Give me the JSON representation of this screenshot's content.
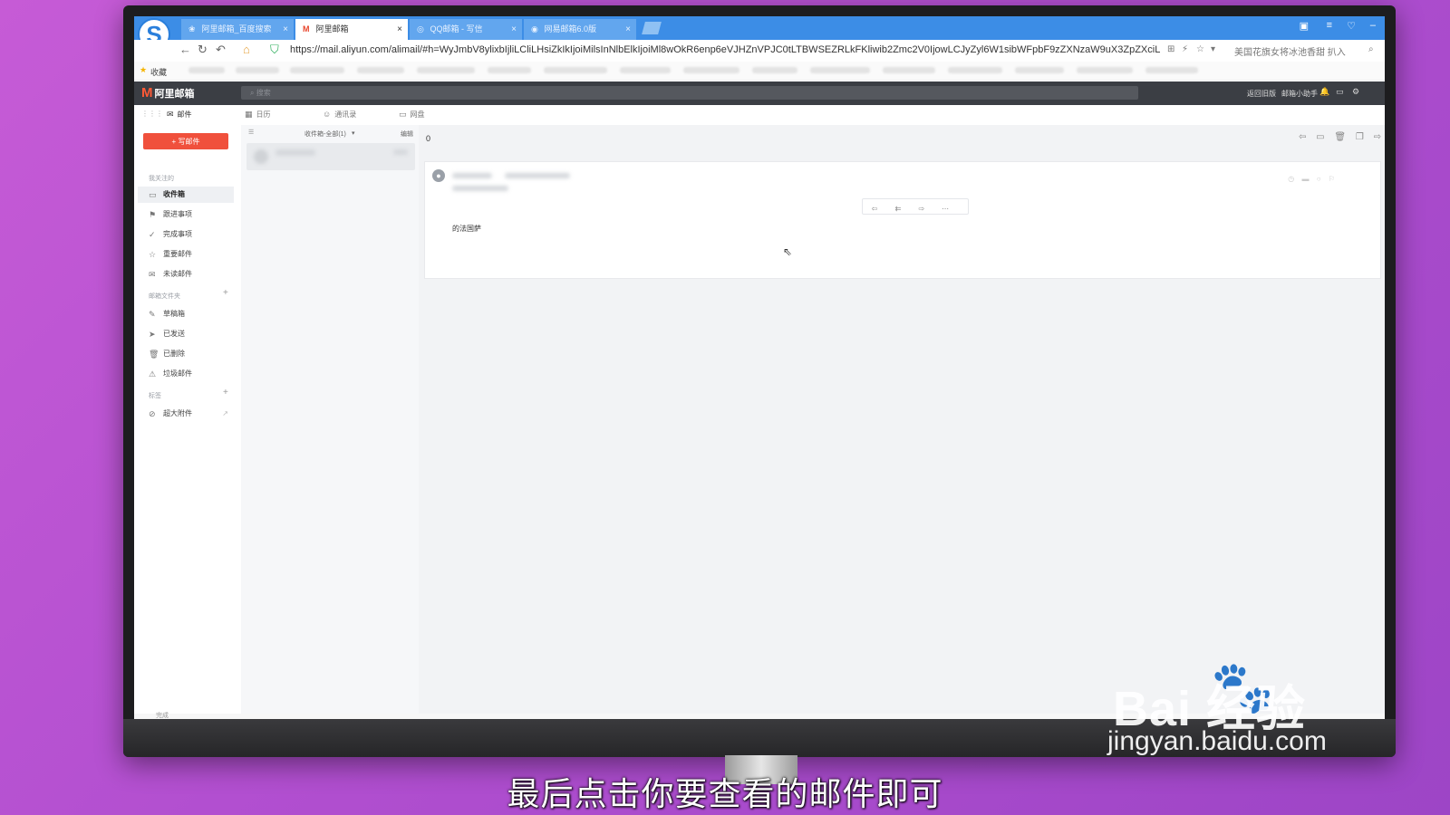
{
  "browser": {
    "tabs": [
      {
        "label": "阿里邮箱_百度搜索",
        "fav": "❀"
      },
      {
        "label": "阿里邮箱",
        "fav": "M"
      },
      {
        "label": "QQ邮箱 - 写信",
        "fav": "◎"
      },
      {
        "label": "网易邮箱6.0版",
        "fav": "◉"
      }
    ],
    "url": "https://mail.aliyun.com/alimail/#h=WyJmbV8ylixbIjliLCliLHsiZkIkIjoiMilsInNlbElkIjoiMl8wOkR6enp6eVJHZnVPJC0tLTBWSEZRLkFKliwib2Zmc2V0IjowLCJyZyl6W1sibWFpbF9zZXNzaW9uX3ZpZXciLHsiaWC",
    "bookmarks_label": "收藏",
    "right_text": "美国花旗女将冰池香甜 扒入"
  },
  "app": {
    "logo": "阿里邮箱",
    "search_placeholder": "搜索",
    "header_links": [
      "返回旧版",
      "邮箱小助手"
    ],
    "modules": [
      "邮件",
      "日历",
      "通讯录",
      "网盘"
    ]
  },
  "sidebar": {
    "compose_label": "+ 写邮件",
    "section_followed": "我关注的",
    "items_followed": [
      {
        "label": "收件箱",
        "icon": "▭"
      },
      {
        "label": "跟进事项",
        "icon": "⚑"
      },
      {
        "label": "完成事项",
        "icon": "✓"
      },
      {
        "label": "重要邮件",
        "icon": "☆"
      },
      {
        "label": "未读邮件",
        "icon": "✉"
      }
    ],
    "section_folders": "邮箱文件夹",
    "items_folders": [
      {
        "label": "草稿箱",
        "icon": "✎"
      },
      {
        "label": "已发送",
        "icon": "➤"
      },
      {
        "label": "已删除",
        "icon": "🗑"
      },
      {
        "label": "垃圾邮件",
        "icon": "⚠"
      }
    ],
    "section_tags": "标签",
    "item_attachments": {
      "label": "超大附件",
      "icon": "⊘"
    }
  },
  "list": {
    "filter_label": "收件箱-全部(1)",
    "edit_label": "编辑"
  },
  "read": {
    "count": "0",
    "body": "的法国萨"
  },
  "status": {
    "text": "完成"
  },
  "watermark": {
    "brand": "Bai 经验",
    "url": "jingyan.baidu.com"
  },
  "subtitle": "最后点击你要查看的邮件即可"
}
